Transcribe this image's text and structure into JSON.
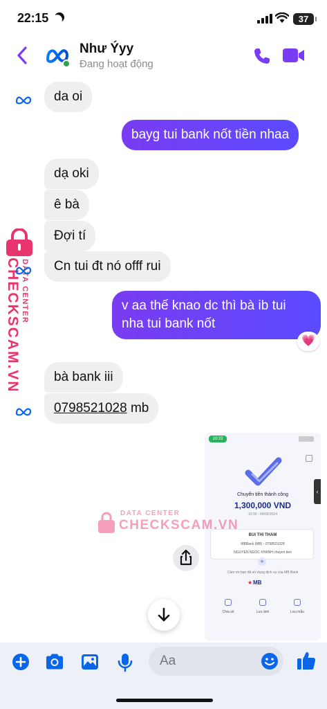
{
  "status_bar": {
    "time": "22:15",
    "battery": "37"
  },
  "header": {
    "contact_name": "Như Ýyy",
    "contact_status": "Đang hoạt động"
  },
  "messages": [
    {
      "from": "them",
      "text": "da oi"
    },
    {
      "from": "me",
      "text": "bayg tui bank nốt tiền nhaa"
    },
    {
      "from": "them",
      "text": "dạ oki"
    },
    {
      "from": "them",
      "text": "ê bà"
    },
    {
      "from": "them",
      "text": "Đợi tí"
    },
    {
      "from": "them",
      "text": "Cn tui đt nó offf rui"
    },
    {
      "from": "me",
      "line1": "v aa thế knao dc thì bà ib tui",
      "line2": "nha tui bank nốt"
    },
    {
      "from": "them",
      "text": "bà bank iii"
    },
    {
      "from": "them",
      "account_number": "0798521028",
      "suffix": " mb"
    }
  ],
  "reaction": {
    "emoji": "💗"
  },
  "watermark": {
    "small": "DATA CENTER",
    "big": "CHECKSCAM.VN"
  },
  "receipt_image": {
    "status_time": "10:23",
    "title": "Chuyển tiền thành công",
    "amount": "1,300,000 VND",
    "timestamp": "10:30 - 04/09/2024",
    "recipient_name": "BUI THI THAM",
    "recipient_bank": "MBBank (MB) - 0798521028",
    "note": "NGUYEN NGOC KHANH chuyen tien",
    "thanks": "Cảm ơn bạn đã sử dụng dịch vụ của MB Bank",
    "bank_logo": "MB",
    "actions": [
      "Chia sẻ",
      "Lưu ảnh",
      "Lưu mẫu"
    ]
  },
  "composer": {
    "placeholder": "Aa"
  },
  "colors": {
    "accent": "#7a3cf2",
    "bubble_in": "#eeeff1",
    "watermark": "#e8356d"
  }
}
